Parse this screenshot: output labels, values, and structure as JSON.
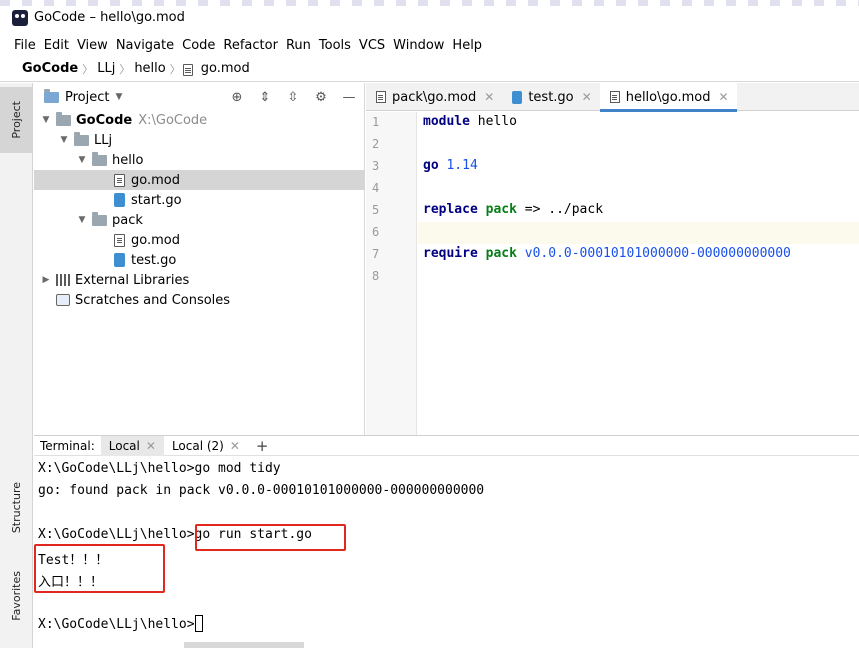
{
  "window": {
    "title": "GoCode – hello\\go.mod"
  },
  "menu": [
    "File",
    "Edit",
    "View",
    "Navigate",
    "Code",
    "Refactor",
    "Run",
    "Tools",
    "VCS",
    "Window",
    "Help"
  ],
  "breadcrumb": [
    "GoCode",
    "LLj",
    "hello",
    "go.mod"
  ],
  "left_strip": {
    "project": "Project",
    "structure": "Structure",
    "favorites": "Favorites"
  },
  "project_panel": {
    "title": "Project",
    "tree": [
      {
        "label": "GoCode",
        "hint": "X:\\GoCode"
      },
      {
        "label": "LLj"
      },
      {
        "label": "hello"
      },
      {
        "label": "go.mod"
      },
      {
        "label": "start.go"
      },
      {
        "label": "pack"
      },
      {
        "label": "go.mod"
      },
      {
        "label": "test.go"
      },
      {
        "label": "External Libraries"
      },
      {
        "label": "Scratches and Consoles"
      }
    ]
  },
  "editor": {
    "tabs": [
      {
        "label": "pack\\go.mod"
      },
      {
        "label": "test.go"
      },
      {
        "label": "hello\\go.mod"
      }
    ],
    "line_numbers": [
      "1",
      "2",
      "3",
      "4",
      "5",
      "6",
      "7",
      "8"
    ],
    "code": {
      "l1_kw": "module",
      "l1_rest": " hello",
      "l3_kw": "go",
      "l3_num": "1.14",
      "l5_kw": "replace",
      "l5_pkg": "pack",
      "l5_rest": " => ../pack",
      "l7_kw": "require",
      "l7_pkg": "pack",
      "l7_ver": "v0.0.0-00010101000000-000000000000"
    }
  },
  "terminal": {
    "label": "Terminal:",
    "tabs": [
      {
        "label": "Local"
      },
      {
        "label": "Local (2)"
      }
    ],
    "add": "+",
    "lines": [
      "X:\\GoCode\\LLj\\hello>go mod tidy",
      "go: found pack in pack v0.0.0-00010101000000-000000000000",
      "",
      "X:\\GoCode\\LLj\\hello>go run start.go",
      "Test！！！",
      "入口！！！",
      "",
      "X:\\GoCode\\LLj\\hello>"
    ]
  }
}
